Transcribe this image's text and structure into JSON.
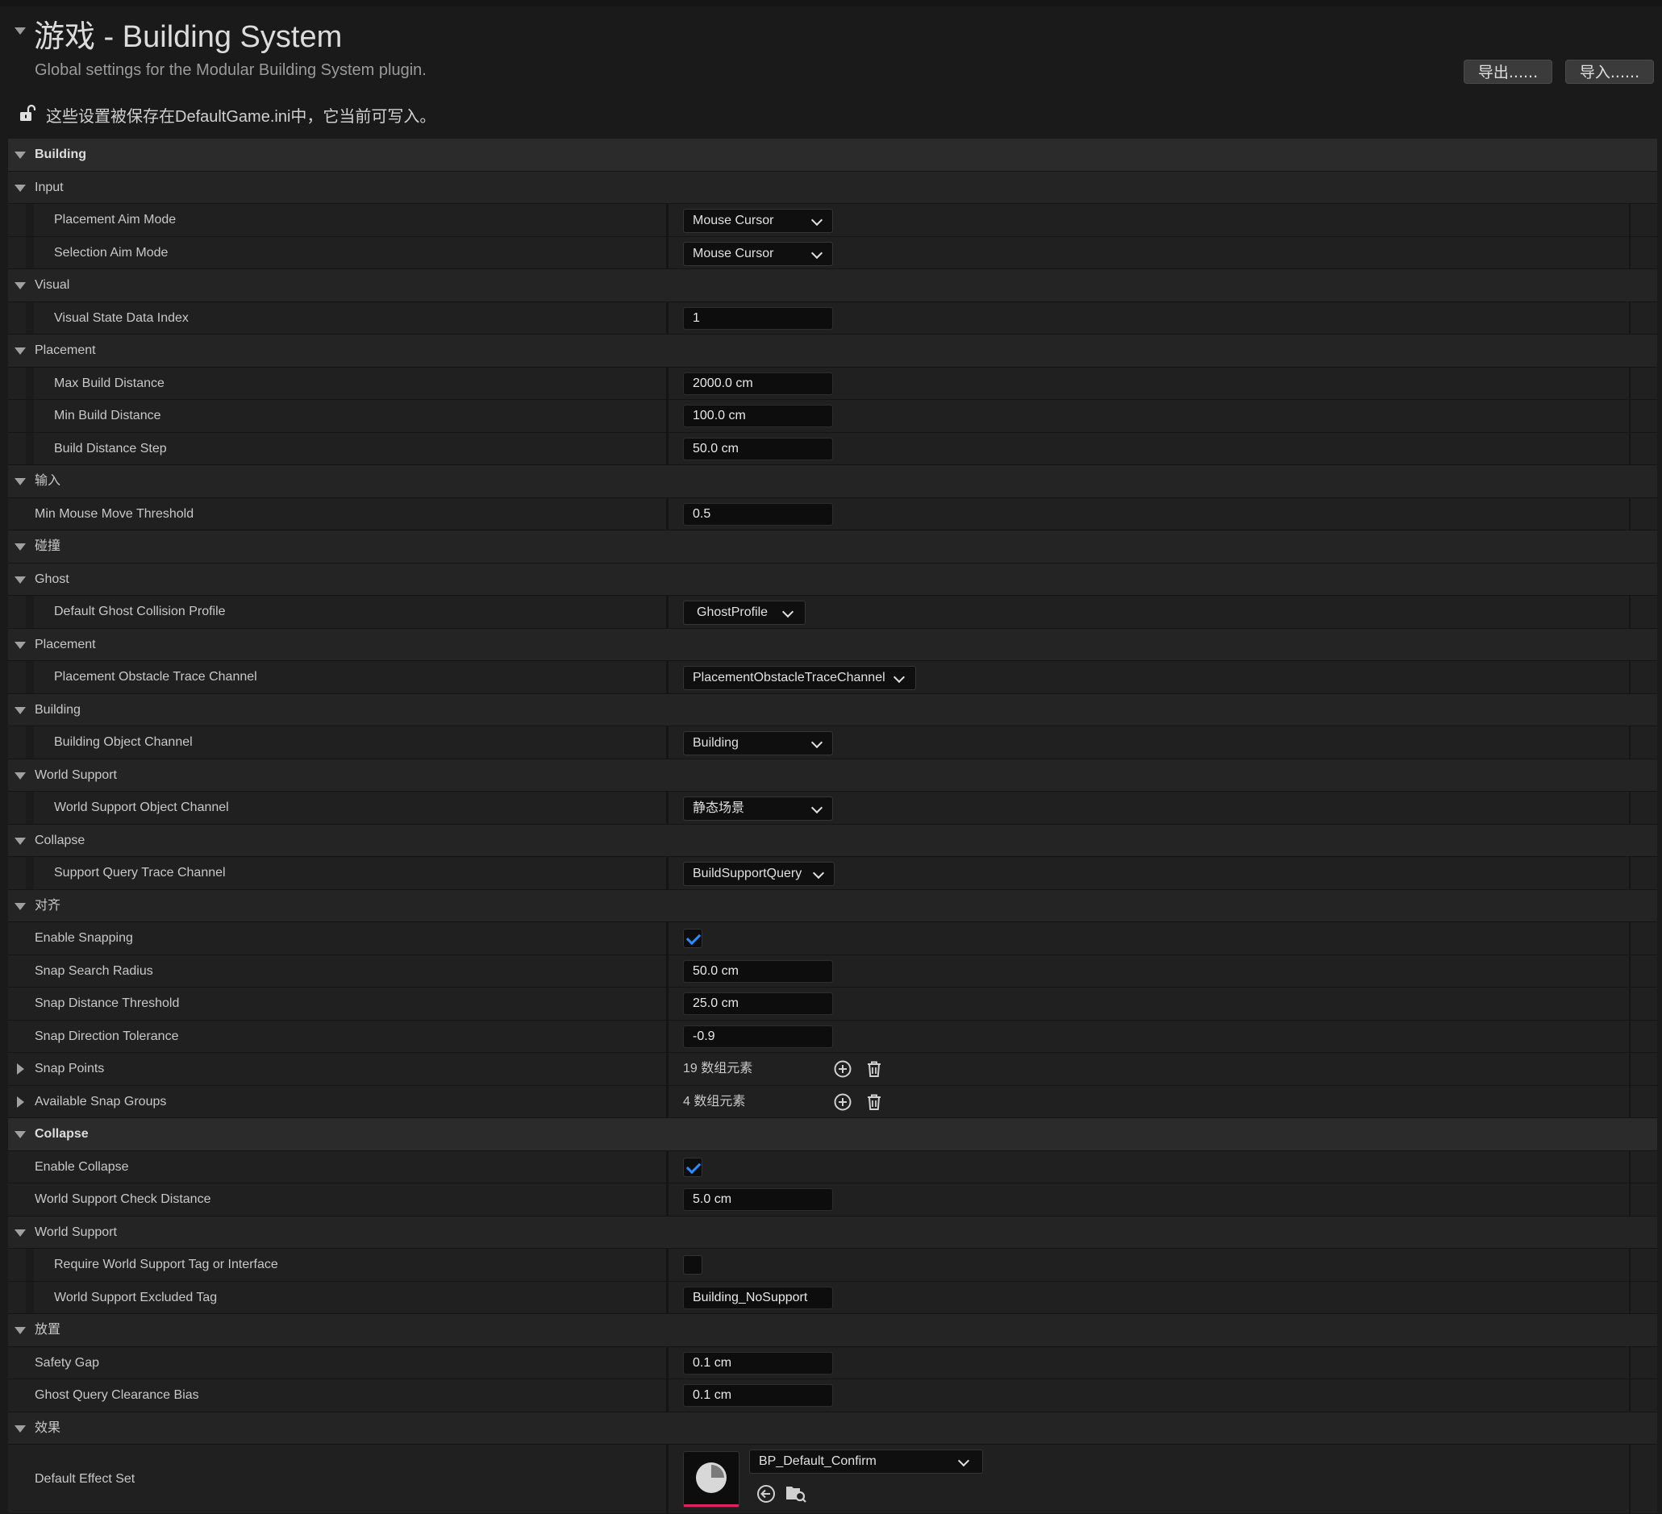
{
  "header": {
    "title": "游戏 - Building System",
    "subtitle": "Global settings for the Modular Building System plugin.",
    "export_label": "导出......",
    "import_label": "导入......",
    "save_note": "这些设置被保存在DefaultGame.ini中，它当前可写入。"
  },
  "sections": {
    "building": "Building",
    "input": "Input",
    "visual": "Visual",
    "placement": "Placement",
    "input_cn": "输入",
    "collision": "碰撞",
    "ghost": "Ghost",
    "col_placement": "Placement",
    "col_building": "Building",
    "col_world_support": "World Support",
    "col_collapse": "Collapse",
    "snap": "对齐",
    "collapse": "Collapse",
    "world_support": "World Support",
    "placement_cn": "放置",
    "effects": "效果"
  },
  "props": {
    "placement_aim_mode": {
      "label": "Placement Aim Mode",
      "value": "Mouse Cursor"
    },
    "selection_aim_mode": {
      "label": "Selection Aim Mode",
      "value": "Mouse Cursor"
    },
    "visual_state_data_index": {
      "label": "Visual State Data Index",
      "value": "1"
    },
    "max_build_distance": {
      "label": "Max Build Distance",
      "value": "2000.0 cm"
    },
    "min_build_distance": {
      "label": "Min Build Distance",
      "value": "100.0 cm"
    },
    "build_distance_step": {
      "label": "Build Distance Step",
      "value": "50.0 cm"
    },
    "min_mouse_move_threshold": {
      "label": "Min Mouse Move Threshold",
      "value": "0.5"
    },
    "default_ghost_collision_profile": {
      "label": "Default Ghost Collision Profile",
      "value": "GhostProfile"
    },
    "placement_obstacle_trace_channel": {
      "label": "Placement Obstacle Trace Channel",
      "value": "PlacementObstacleTraceChannel"
    },
    "building_object_channel": {
      "label": "Building Object Channel",
      "value": "Building"
    },
    "world_support_object_channel": {
      "label": "World Support Object Channel",
      "value": "静态场景"
    },
    "support_query_trace_channel": {
      "label": "Support Query Trace Channel",
      "value": "BuildSupportQuery"
    },
    "enable_snapping": {
      "label": "Enable Snapping",
      "checked": true
    },
    "snap_search_radius": {
      "label": "Snap Search Radius",
      "value": "50.0 cm"
    },
    "snap_distance_threshold": {
      "label": "Snap Distance Threshold",
      "value": "25.0 cm"
    },
    "snap_direction_tolerance": {
      "label": "Snap Direction Tolerance",
      "value": "-0.9"
    },
    "snap_points": {
      "label": "Snap Points",
      "value": "19 数组元素"
    },
    "available_snap_groups": {
      "label": "Available Snap Groups",
      "value": "4 数组元素"
    },
    "enable_collapse": {
      "label": "Enable Collapse",
      "checked": true
    },
    "world_support_check_distance": {
      "label": "World Support Check Distance",
      "value": "5.0 cm"
    },
    "require_world_support_tag": {
      "label": "Require World Support Tag or Interface",
      "checked": false
    },
    "world_support_excluded_tag": {
      "label": "World Support Excluded Tag",
      "value": "Building_NoSupport"
    },
    "safety_gap": {
      "label": "Safety Gap",
      "value": "0.1 cm"
    },
    "ghost_query_clearance_bias": {
      "label": "Ghost Query Clearance Bias",
      "value": "0.1 cm"
    },
    "default_effect_set": {
      "label": "Default Effect Set",
      "value": "BP_Default_Confirm"
    }
  },
  "colors": {
    "background": "#1a1a1a",
    "category_row": "#2b2b2b",
    "check_accent": "#2a8cff",
    "asset_underline": "#e0245e"
  },
  "icons": [
    "chevron-down-icon",
    "unlock-icon",
    "add-element-icon",
    "delete-all-icon",
    "browse-to-asset-icon",
    "use-selected-icon",
    "pie-thumbnail-icon"
  ]
}
